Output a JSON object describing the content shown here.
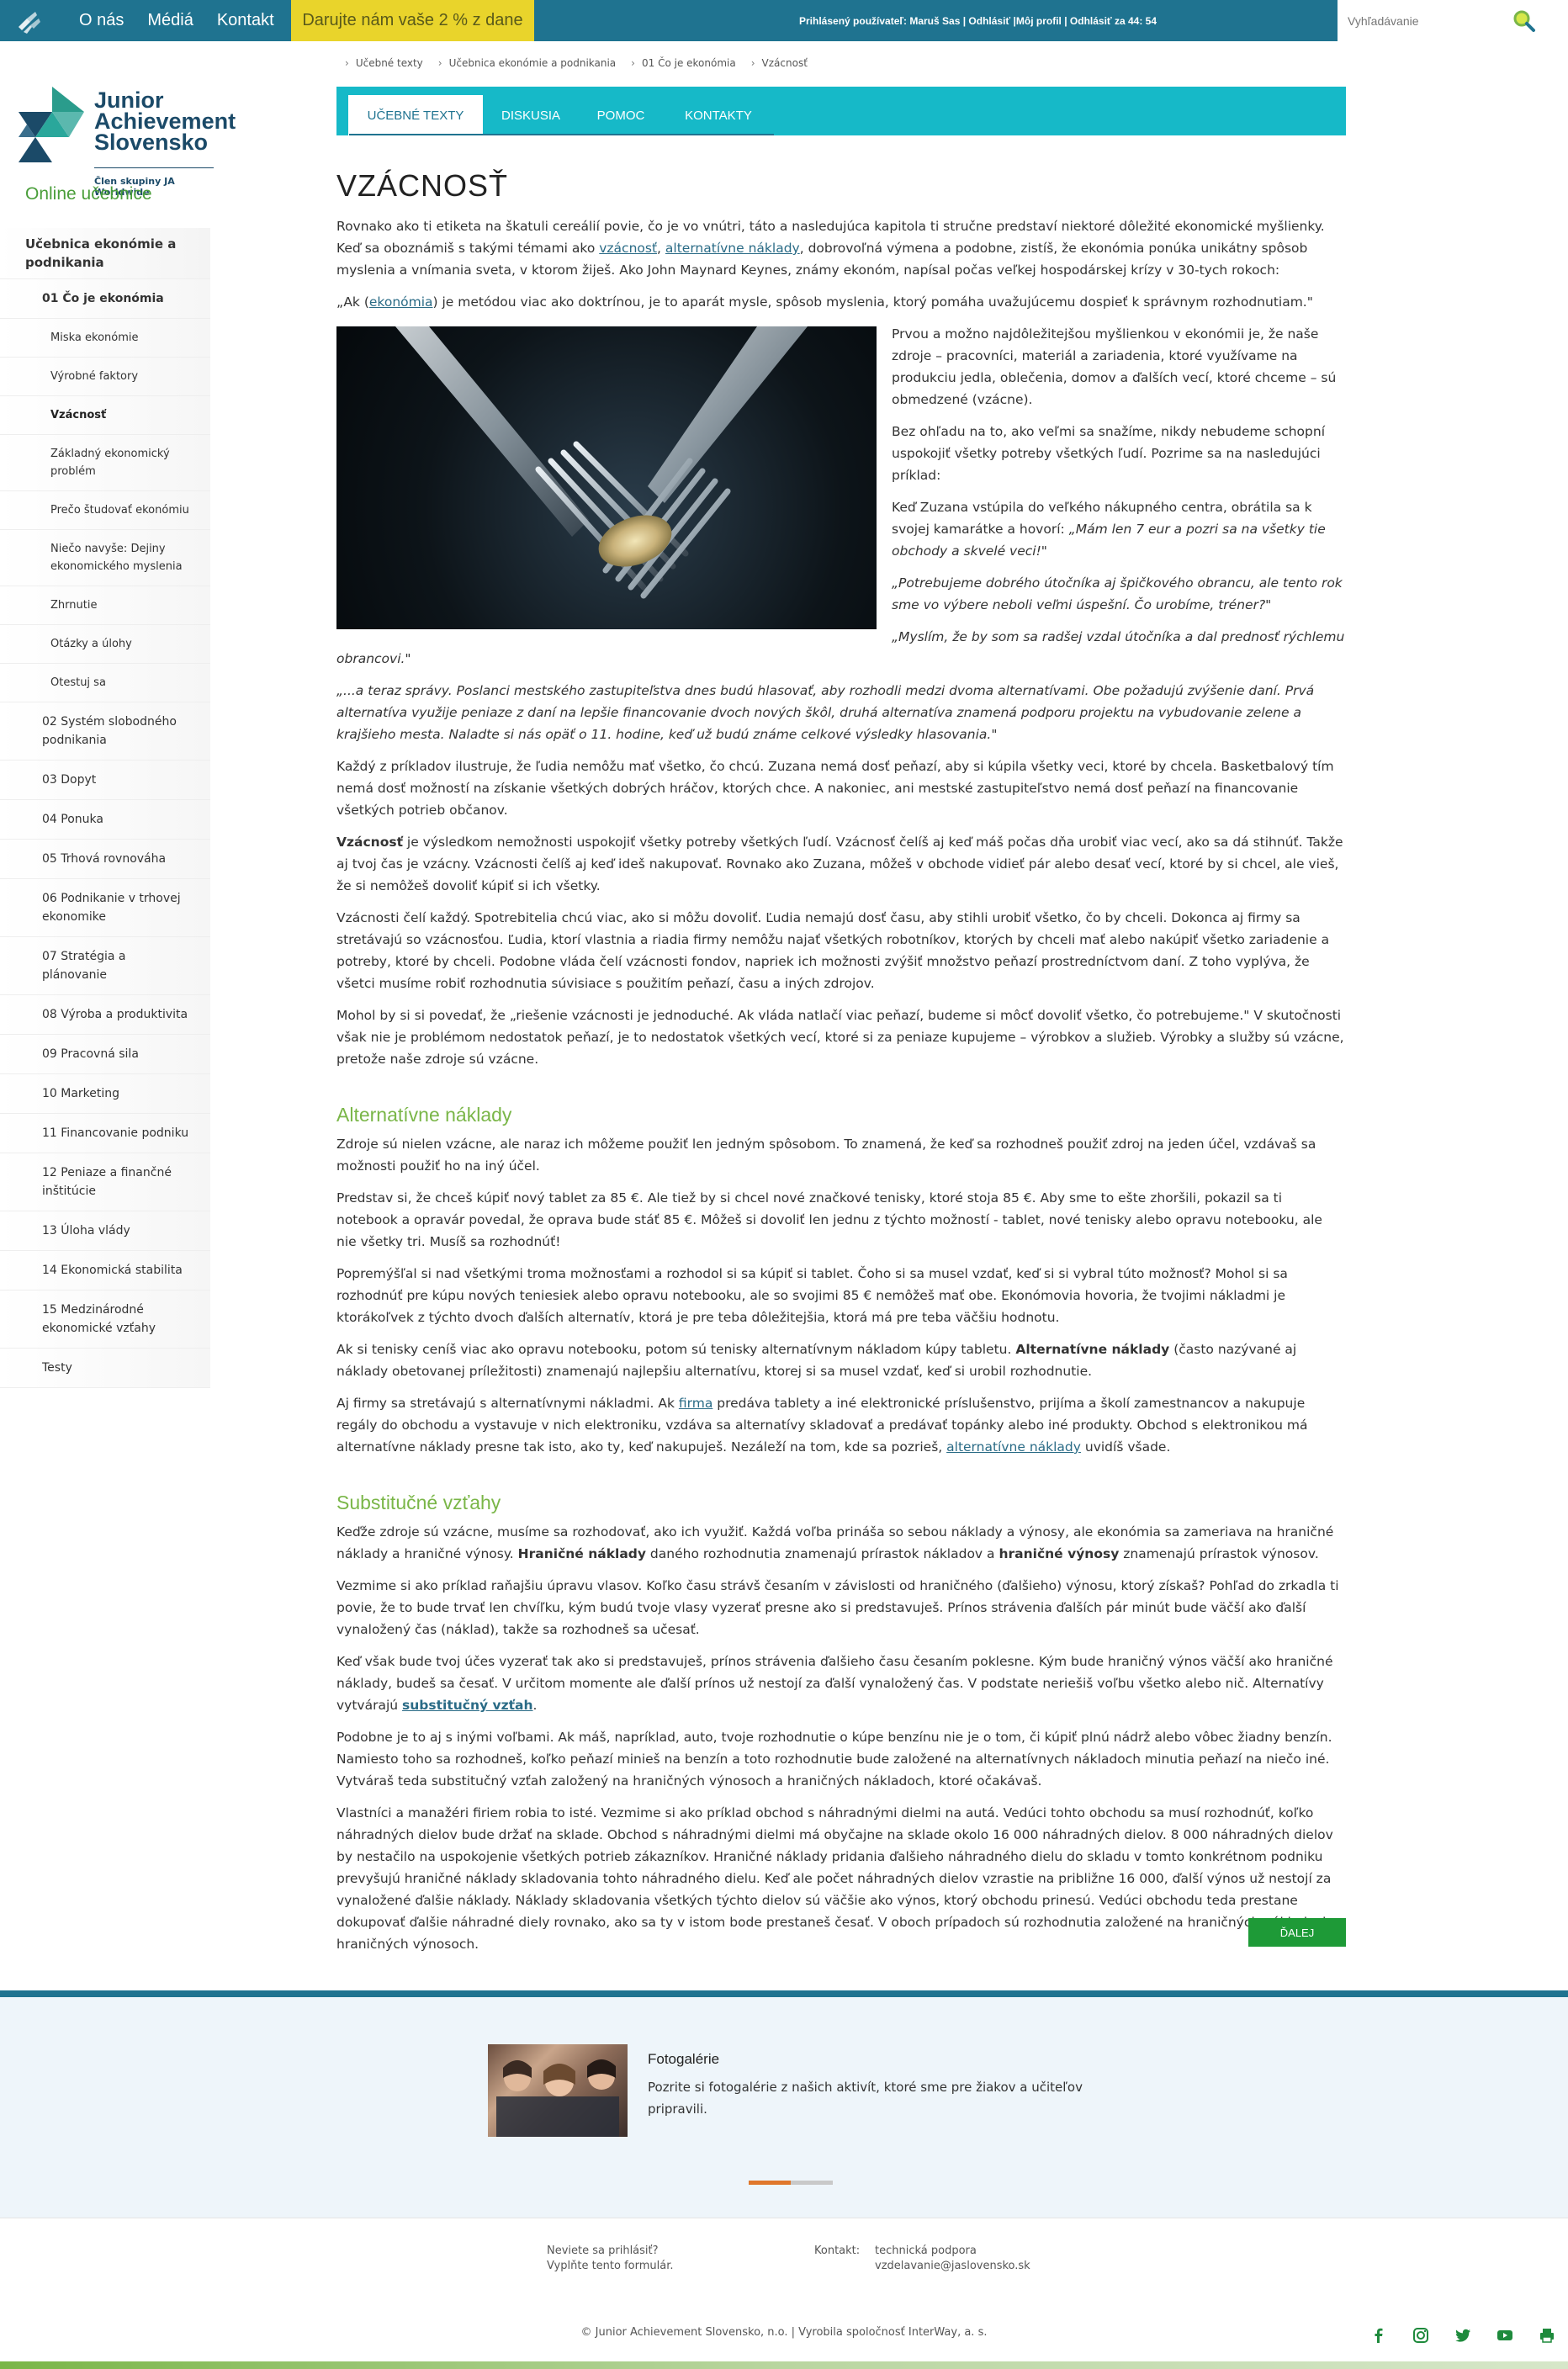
{
  "topbar": {
    "nav": [
      "O nás",
      "Médiá",
      "Kontakt"
    ],
    "donate": "Darujte nám vaše 2 % z dane",
    "user_prefix": "Prihlásený používateľ:",
    "user_name": "Maruš Sas",
    "logout": "Odhlásiť",
    "profile": "Môj profil",
    "logout_timer": "Odhlásiť za 44: 54",
    "search_placeholder": "Vyhľadávanie"
  },
  "brand": {
    "name_line1": "Junior",
    "name_line2": "Achievement",
    "name_line3": "Slovensko",
    "sub": "Člen skupiny JA Worldwide"
  },
  "sidebar": {
    "title": "Online učebnice",
    "items": [
      {
        "label": "Učebnica ekonómie a podnikania",
        "level": 0
      },
      {
        "label": "01 Čo je ekonómia",
        "level": 1,
        "bold": true
      },
      {
        "label": "Miska ekonómie",
        "level": 2
      },
      {
        "label": "Výrobné faktory",
        "level": 2
      },
      {
        "label": "Vzácnosť",
        "level": 2,
        "current": true
      },
      {
        "label": "Základný ekonomický problém",
        "level": 2
      },
      {
        "label": "Prečo študovať ekonómiu",
        "level": 2
      },
      {
        "label": "Niečo navyše: Dejiny ekonomického myslenia",
        "level": 2
      },
      {
        "label": "Zhrnutie",
        "level": 2
      },
      {
        "label": "Otázky a úlohy",
        "level": 2
      },
      {
        "label": "Otestuj sa",
        "level": 2
      },
      {
        "label": "02 Systém slobodného podnikania",
        "level": 1
      },
      {
        "label": "03 Dopyt",
        "level": 1
      },
      {
        "label": "04 Ponuka",
        "level": 1
      },
      {
        "label": "05 Trhová rovnováha",
        "level": 1
      },
      {
        "label": "06 Podnikanie v trhovej ekonomike",
        "level": 1
      },
      {
        "label": "07 Stratégia a plánovanie",
        "level": 1
      },
      {
        "label": "08 Výroba a produktivita",
        "level": 1
      },
      {
        "label": "09 Pracovná sila",
        "level": 1
      },
      {
        "label": "10 Marketing",
        "level": 1
      },
      {
        "label": "11 Financovanie podniku",
        "level": 1
      },
      {
        "label": "12 Peniaze a finančné inštitúcie",
        "level": 1
      },
      {
        "label": "13 Úloha vlády",
        "level": 1
      },
      {
        "label": "14 Ekonomická stabilita",
        "level": 1
      },
      {
        "label": "15 Medzinárodné ekonomické vzťahy",
        "level": 1
      },
      {
        "label": "Testy",
        "level": 1
      }
    ]
  },
  "breadcrumb": [
    "Učebné texty",
    "Učebnica ekonómie a podnikania",
    "01 Čo je ekonómia",
    "Vzácnosť"
  ],
  "tabs": [
    "UČEBNÉ TEXTY",
    "DISKUSIA",
    "POMOC",
    "KONTAKTY"
  ],
  "article": {
    "title": "VZÁCNOSŤ",
    "intro_p1": "Rovnako ako ti etiketa na škatuli cereálií povie, čo je vo vnútri, táto a nasledujúca kapitola ti stručne predstaví niektoré dôležité ekonomické myšlienky. Keď sa oboznámiš s takými témami ako vzácnosť, alternatívne náklady, dobrovoľná výmena a podobne, zistíš, že ekonómia ponúka unikátny spôsob myslenia a vnímania sveta, v ktorom žiješ. Ako John Maynard Keynes, známy ekonóm, napísal počas veľkej hospodárskej krízy v 30-tych rokoch:",
    "quote": "„Ak (ekonómia) je metódou viac ako doktrínou, je to aparát mysle, spôsob myslenia, ktorý pomáha uvažujúcemu dospieť k správnym rozhodnutiam.\"",
    "p_right_1": "Prvou a možno najdôležitejšou myšlienkou v ekonómii je, že naše zdroje – pracovníci, materiál a zariadenia, ktoré využívame na produkciu jedla, oblečenia, domov a ďalších vecí, ktoré chceme – sú obmedzené (vzácne).",
    "p_right_2": "Bez ohľadu na to, ako veľmi sa snažíme, nikdy nebudeme schopní uspokojiť všetky potreby všetkých ľudí. Pozrime sa na nasledujúci príklad:",
    "p_right_3a": "Keď Zuzana vstúpila do veľkého nákupného centra, obrátila sa k svojej kamarátke a hovorí:",
    "p_right_3b": "„Mám len 7 eur a pozri sa na všetky tie obchody a skvelé veci!\"",
    "p_right_4": "„Potrebujeme dobrého útočníka aj špičkového obrancu, ale tento rok sme vo výbere neboli veľmi úspešní. Čo urobíme, tréner?\"",
    "p_right_5": "„Myslím, že by som sa radšej vzdal útočníka a dal prednosť rýchlemu obrancovi.\"",
    "p_news": "„...a teraz správy. Poslanci mestského zastupiteľstva dnes budú hlasovať, aby rozhodli medzi dvoma alternatívami. Obe požadujú zvýšenie daní. Prvá alternatíva využije peniaze z daní na lepšie financovanie dvoch nových škôl, druhá alternatíva znamená podporu projektu na vybudovanie zelene a krajšieho mesta. Naladte si nás opäť o 11. hodine, keď už budú známe celkové výsledky hlasovania.\"",
    "p_each": "Každý z príkladov ilustruje, že ľudia nemôžu mať všetko, čo chcú. Zuzana nemá dosť peňazí, aby si kúpila všetky veci, ktoré by chcela. Basketbalový tím nemá dosť možností na získanie všetkých dobrých hráčov, ktorých chce. A nakoniec, ani mestské zastupiteľstvo nemá dosť peňazí na financovanie všetkých potrieb občanov.",
    "p_scarcity_term": "Vzácnosť",
    "p_scarcity": " je výsledkom nemožnosti uspokojiť všetky potreby všetkých ľudí. Vzácnosť čelíš aj keď máš počas dňa urobiť viac vecí, ako sa dá stihnúť. Takže aj tvoj čas je vzácny. Vzácnosti čelíš aj keď ideš nakupovať. Rovnako ako Zuzana, môžeš v obchode vidieť pár alebo desať vecí, ktoré by si chcel, ale vieš, že si nemôžeš dovoliť kúpiť si ich všetky.",
    "p_everyone": "Vzácnosti čelí každý. Spotrebitelia chcú viac, ako si môžu dovoliť. Ľudia nemajú dosť času, aby stihli urobiť všetko, čo by chceli. Dokonca aj firmy sa stretávajú so vzácnosťou. Ľudia, ktorí vlastnia a riadia firmy nemôžu najať všetkých robotníkov, ktorých by chceli mať alebo nakúpiť všetko zariadenie a potreby, ktoré by chceli. Podobne vláda čelí vzácnosti fondov, napriek ich možnosti zvýšiť množstvo peňazí prostredníctvom daní. Z toho vyplýva, že všetci musíme robiť rozhodnutia súvisiace s použitím peňazí, času a iných zdrojov.",
    "p_solution": "Mohol by si si povedať, že „riešenie vzácnosti je jednoduché. Ak vláda natlačí viac peňazí, budeme si môcť dovoliť všetko, čo potrebujeme.\" V skutočnosti však nie je problémom nedostatok peňazí, je to nedostatok všetkých vecí, ktoré si za peniaze kupujeme – výrobkov a služieb. Výrobky a služby sú vzácne, pretože naše zdroje sú vzácne.",
    "h_alt": "Alternatívne náklady",
    "p_alt1": "Zdroje sú nielen vzácne, ale naraz ich môžeme použiť len jedným spôsobom. To znamená, že keď sa rozhodneš použiť zdroj na jeden účel, vzdávaš sa možnosti použiť ho na iný účel.",
    "p_alt2": "Predstav si, že chceš kúpiť nový tablet za 85 €. Ale tiež by si chcel nové značkové tenisky, ktoré stoja 85 €. Aby sme to ešte zhoršili, pokazil sa ti notebook a opravár povedal, že oprava bude stáť 85 €. Môžeš si dovoliť len jednu z týchto možností - tablet, nové tenisky alebo opravu notebooku, ale nie všetky tri. Musíš sa rozhodnúť!",
    "p_alt3": "Popremýšľal si nad všetkými troma možnosťami a rozhodol si sa kúpiť si tablet. Čoho si sa musel vzdať, keď si si vybral túto možnosť? Mohol si sa rozhodnúť pre kúpu nových teniesiek alebo opravu notebooku, ale so svojimi 85 € nemôžeš mať obe. Ekonómovia hovoria, že tvojimi nákladmi je ktorákoľvek z týchto dvoch ďalších alternatív, ktorá je pre teba dôležitejšia, ktorá má pre teba väčšiu hodnotu.",
    "p_alt4a": "Ak si tenisky ceníš viac ako opravu notebooku, potom sú tenisky alternatívnym nákladom kúpy tabletu.",
    "p_alt4_term": "Alternatívne náklady",
    "p_alt4b": " (často nazývané aj náklady obetovanej príležitosti) znamenajú najlepšiu alternatívu, ktorej si sa musel vzdať, keď si urobil rozhodnutie.",
    "p_alt5a": "Aj firmy sa stretávajú s alternatívnymi nákladmi. Ak ",
    "p_alt5_link": "firma",
    "p_alt5b": " predáva tablety a iné elektronické príslušenstvo, prijíma a školí zamestnancov a nakupuje regály do obchodu a vystavuje v nich elektroniku, vzdáva sa alternatívy skladovať a predávať topánky alebo iné produkty. Obchod s elektronikou má alternatívne náklady presne tak isto, ako ty, keď nakupuješ. Nezáleží na tom, kde sa pozrieš, ",
    "p_alt5_link2": "alternatívne náklady",
    "p_alt5c": " uvidíš všade.",
    "h_sub": "Substitučné vzťahy",
    "p_sub1a": "Keďže zdroje sú vzácne, musíme sa rozhodovať, ako ich využiť. Každá voľba prináša so sebou náklady a výnosy, ale ekonómia sa zameriava na hraničné náklady a hraničné výnosy. ",
    "p_sub1_term1": "Hraničné náklady",
    "p_sub1b": " daného rozhodnutia znamenajú prírastok nákladov a ",
    "p_sub1_term2": "hraničné výnosy",
    "p_sub1c": " znamenajú prírastok výnosov.",
    "p_sub2": "Vezmime si ako príklad raňajšiu úpravu vlasov. Koľko času strávš česaním v závislosti od hraničného (ďalšieho) výnosu, ktorý získaš? Pohľad do zrkadla ti povie, že to bude trvať len chvíľku, kým budú tvoje vlasy vyzerať presne ako si predstavuješ. Prínos strávenia ďalších pár minút bude väčší ako ďalší vynaložený čas (náklad), takže sa rozhodneš sa učesať.",
    "p_sub3a": "Keď však bude tvoj účes vyzerať tak ako si predstavuješ, prínos strávenia ďalšieho času česaním poklesne. Kým bude hraničný výnos väčší ako hraničné náklady, budeš sa česať. V určitom momente ale ďalší prínos už nestojí za ďalší vynaložený čas. V podstate neriešiš voľbu všetko alebo nič. Alternatívy vytvárajú ",
    "p_sub3_link": "substitučný vzťah",
    "p_sub3b": ".",
    "p_sub4": "Podobne je to aj s inými voľbami. Ak máš, napríklad, auto, tvoje rozhodnutie o kúpe benzínu nie je o tom, či kúpiť plnú nádrž alebo vôbec žiadny benzín. Namiesto toho sa rozhodneš, koľko peňazí minieš na benzín a toto rozhodnutie bude založené na alternatívnych nákladoch minutia peňazí na niečo iné. Vytváraš teda substitučný vzťah založený na hraničných výnosoch a hraničných nákladoch, ktoré očakávaš.",
    "p_sub5": "Vlastníci a manažéri firiem robia to isté. Vezmime si ako príklad obchod s náhradnými dielmi na autá. Vedúci tohto obchodu sa musí rozhodnúť, koľko náhradných dielov bude držať na sklade. Obchod s náhradnými dielmi má obyčajne na sklade okolo 16 000 náhradných dielov. 8 000 náhradných dielov by nestačilo na uspokojenie všetkých potrieb zákazníkov. Hraničné náklady pridania ďalšieho náhradného dielu do skladu v tomto konkrétnom podniku prevyšujú hraničné náklady skladovania tohto náhradného dielu. Keď ale počet náhradných dielov vzrastie na približne 16 000, ďalší výnos už nestojí za vynaložené ďalšie náklady. Náklady skladovania všetkých týchto dielov sú väčšie ako výnos, ktorý obchodu prinesú. Vedúci obchodu teda prestane dokupovať ďalšie náhradné diely rovnako, ako sa ty v istom bode prestaneš česať. V oboch prípadoch sú rozhodnutia založené na hraničných nákladoch a hraničných výnosoch.",
    "next": "ĎALEJ"
  },
  "gallery": {
    "title": "Fotogalérie",
    "text": "Pozrite si fotogalérie z našich aktivít, ktoré sme pre žiakov a učiteľov pripravili."
  },
  "footer": {
    "login_q": "Neviete sa prihlásiť?",
    "login_form": "Vyplňte tento formulár.",
    "contact_label": "Kontakt:",
    "contact_line1": "technická podpora",
    "contact_line2": "vzdelavanie@jaslovensko.sk",
    "copyright": "© Junior Achievement Slovensko, n.o. | Vyrobila spoločnosť InterWay, a. s."
  }
}
